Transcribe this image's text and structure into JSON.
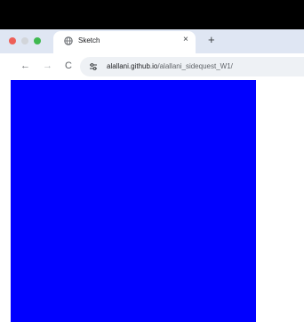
{
  "tab": {
    "title": "Sketch",
    "close_glyph": "×",
    "new_tab_glyph": "+",
    "icon": "globe-icon"
  },
  "toolbar": {
    "back_glyph": "←",
    "forward_glyph": "→",
    "reload_glyph": "C",
    "site_settings_icon": "tune-icon",
    "url_host": "alallani.github.io",
    "url_path": "/alallani_sidequest_W1/"
  },
  "colors": {
    "canvas_fill": "#0000ff",
    "titlebar": "#000000",
    "tab_strip": "#dfe6f3",
    "traffic_close": "#ee5f57",
    "traffic_min": "#d2d5da",
    "traffic_max": "#3fb950"
  }
}
